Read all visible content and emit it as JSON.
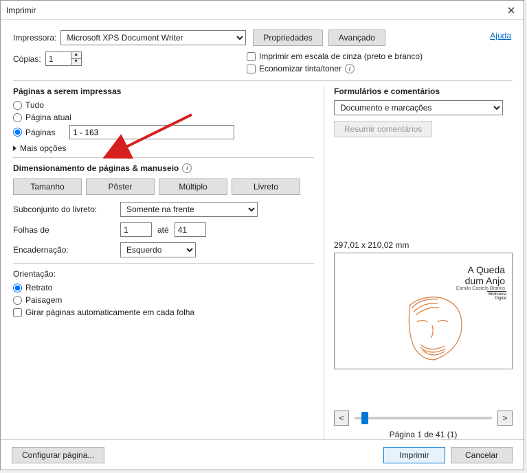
{
  "title": "Imprimir",
  "help": "Ajuda",
  "printer": {
    "label": "Impressora:",
    "value": "Microsoft XPS Document Writer",
    "props": "Propriedades",
    "adv": "Avançado"
  },
  "copies": {
    "label": "Cópias:",
    "value": "1"
  },
  "opts": {
    "gray": "Imprimir em escala de cinza (preto e branco)",
    "save": "Economizar tinta/toner"
  },
  "pages": {
    "title": "Páginas a serem impressas",
    "all": "Tudo",
    "current": "Página atual",
    "range_label": "Páginas",
    "range_value": "1 - 163",
    "more": "Mais opções"
  },
  "sizing": {
    "title": "Dimensionamento de páginas & manuseio",
    "size": "Tamanho",
    "poster": "Pôster",
    "multi": "Múltiplo",
    "booklet": "Livreto",
    "subset_label": "Subconjunto do livreto:",
    "subset_value": "Somente na frente",
    "sheets_label": "Folhas de",
    "from": "1",
    "to_label": "até",
    "to": "41",
    "bind_label": "Encadernação:",
    "bind_value": "Esquerdo"
  },
  "orient": {
    "title": "Orientação:",
    "portrait": "Retrato",
    "landscape": "Paisagem",
    "auto": "Girar páginas automaticamente em cada folha"
  },
  "forms": {
    "title": "Formulários e comentários",
    "value": "Documento e marcações",
    "summarize": "Resumir comentários"
  },
  "preview": {
    "dim": "297,01 x 210,02 mm",
    "book_title1": "A Queda",
    "book_title2": "dum Anjo",
    "book_author": "Camilo Castelo Branco",
    "stamp": "Biblioteca Digital",
    "prev": "<",
    "next": ">",
    "pager": "Página 1 de 41 (1)"
  },
  "footer": {
    "setup": "Configurar página...",
    "print": "Imprimir",
    "cancel": "Cancelar"
  }
}
